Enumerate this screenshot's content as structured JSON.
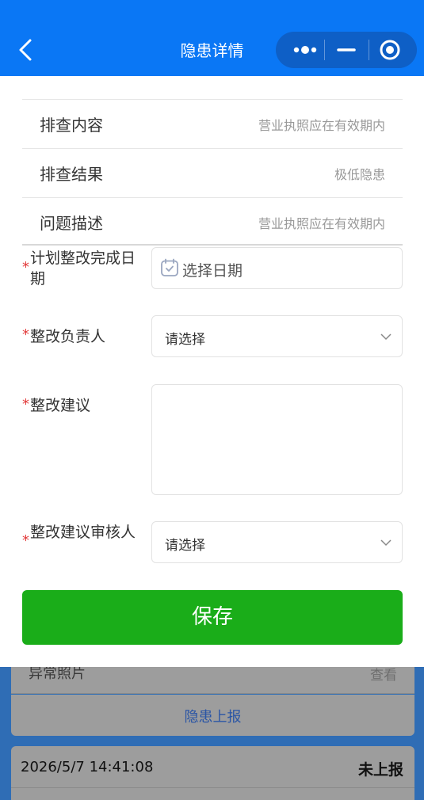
{
  "navbar": {
    "title": "隐患详情",
    "back_icon": "back-arrow-icon",
    "more_icon": "more-dots-icon",
    "minimize_icon": "minimize-icon",
    "close_icon": "target-close-icon",
    "bg_color": "#0a77f5"
  },
  "info_rows": [
    {
      "label": "排查内容",
      "value": "营业执照应在有效期内"
    },
    {
      "label": "排查结果",
      "value": "极低隐患"
    },
    {
      "label": "问题描述",
      "value": "营业执照应在有效期内"
    }
  ],
  "form": {
    "required_mark": "*",
    "plan_date": {
      "label": "计划整改完成日期",
      "placeholder": "选择日期",
      "icon": "calendar-icon"
    },
    "owner": {
      "label": "整改负责人",
      "placeholder": "请选择"
    },
    "suggestion": {
      "label": "整改建议",
      "value": ""
    },
    "reviewer": {
      "label": "整改建议审核人",
      "placeholder": "请选择"
    }
  },
  "save_button": {
    "label": "保存",
    "color": "#1aad19"
  },
  "background": {
    "photo_label": "异常照片",
    "photo_action": "查看",
    "report_button": "隐患上报",
    "next_record": {
      "time": "2026/5/7 14:41:08",
      "status": "未上报"
    }
  }
}
